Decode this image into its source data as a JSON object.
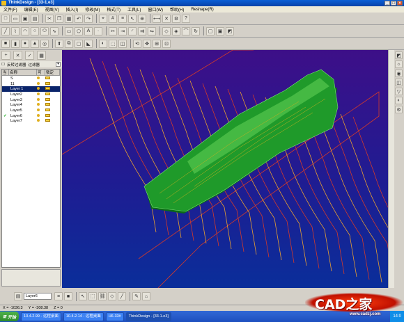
{
  "window": {
    "title": "ThinkDesign - [33-1.e3]"
  },
  "menu": {
    "items": [
      "文件(F)",
      "编辑(E)",
      "视图(V)",
      "插入(I)",
      "修改(M)",
      "格式(T)",
      "工具(L)",
      "窗口(W)",
      "帮助(H)",
      "Reshape(R)"
    ]
  },
  "left_panel": {
    "filter_label": "反转过滤器",
    "filter_label2": "过滤器",
    "headers": [
      "当",
      "名称",
      "可",
      "锁定"
    ],
    "layers": [
      {
        "name": "S",
        "current": false,
        "selected": false
      },
      {
        "name": "11",
        "current": false,
        "selected": false
      },
      {
        "name": "Layer 1",
        "current": false,
        "selected": true
      },
      {
        "name": "Layer2",
        "current": false,
        "selected": false
      },
      {
        "name": "Layer3",
        "current": false,
        "selected": false
      },
      {
        "name": "Layer4",
        "current": false,
        "selected": false
      },
      {
        "name": "Layer5",
        "current": false,
        "selected": false
      },
      {
        "name": "Layer6",
        "current": true,
        "selected": false
      },
      {
        "name": "Layer7",
        "current": false,
        "selected": false
      }
    ]
  },
  "bottom": {
    "current_layer": "Layer6"
  },
  "status": {
    "x": "X = -1036.3",
    "y": "Y = -308.38",
    "z": "Z = 0"
  },
  "taskbar": {
    "start": "开始",
    "items": [
      "10.4.2.99 - 远程桌面",
      "10.4.2.14 - 远程桌面",
      "H6-33#",
      "ThinkDesign - [33-1.e3]"
    ],
    "active_index": 3,
    "clock": "14:0"
  },
  "watermark": {
    "text": "CAD之家",
    "url": "www.cadzj.com"
  },
  "colors": {
    "model": "#1f9a2a",
    "toolpath": "#d33a2a",
    "bg_top": "#3d0f88",
    "bg_bottom": "#0a2e9a"
  }
}
